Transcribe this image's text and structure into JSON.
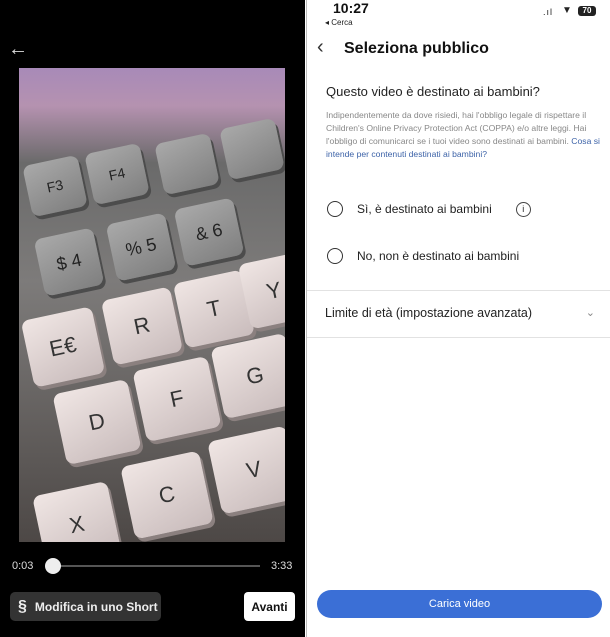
{
  "left": {
    "back_icon": "arrow-left-icon",
    "photo_keys": [
      "R",
      "T",
      "Y",
      "E€",
      "D",
      "F",
      "G",
      "C",
      "V",
      "X",
      "$ 4",
      "% 5",
      "& 6",
      "F3",
      "F4"
    ],
    "time_current": "0:03",
    "time_total": "3:33",
    "progress_percent": 1.4,
    "short_button": "Modifica in uno Short",
    "next_button": "Avanti"
  },
  "status": {
    "time": "10:27",
    "back_app": "◂ Cerca",
    "battery": "70"
  },
  "header": {
    "title": "Seleziona pubblico"
  },
  "section": {
    "question": "Questo video è destinato ai bambini?",
    "description": "Indipendentemente da dove risiedi, hai l'obbligo legale di rispettare il Children's Online Privacy Protection Act (COPPA) e/o altre leggi. Hai l'obbligo di comunicarci se i tuoi video sono destinati ai bambini. ",
    "link": "Cosa si intende per contenuti destinati ai bambini?",
    "options": [
      {
        "label": "Sì, è destinato ai bambini",
        "selected": false
      },
      {
        "label": "No, non è destinato ai bambini",
        "selected": false
      }
    ]
  },
  "age_limit": "Limite di età (impostazione avanzata)",
  "upload_button": "Carica video",
  "colors": {
    "accent": "#3b6fd6",
    "link": "#3d63a8"
  }
}
